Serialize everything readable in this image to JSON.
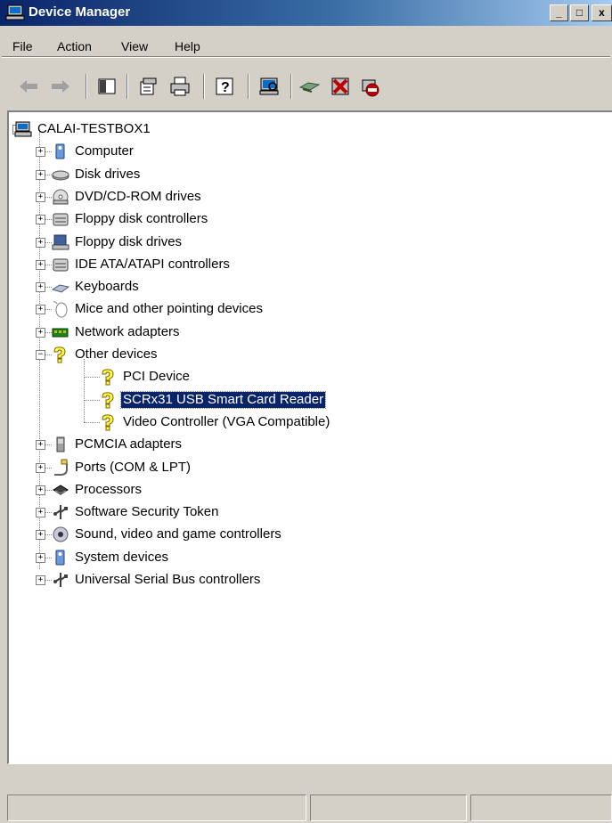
{
  "window": {
    "title": "Device Manager"
  },
  "titlebar": {
    "minimize": "_",
    "maximize": "□",
    "close": "x"
  },
  "menu": [
    "File",
    "Action",
    "View",
    "Help"
  ],
  "toolbar": [
    "back-icon",
    "forward-icon",
    "show-hide-tree-icon",
    "properties-icon",
    "print-icon",
    "help-icon",
    "scan-hardware-icon",
    "update-driver-icon",
    "uninstall-icon",
    "disable-icon"
  ],
  "tree": {
    "root": "CALAI-TESTBOX1",
    "categories": [
      {
        "label": "Computer",
        "icon": "computer-icon"
      },
      {
        "label": "Disk drives",
        "icon": "disk-drive-icon"
      },
      {
        "label": "DVD/CD-ROM drives",
        "icon": "dvd-drive-icon"
      },
      {
        "label": "Floppy disk controllers",
        "icon": "floppy-controller-icon"
      },
      {
        "label": "Floppy disk drives",
        "icon": "floppy-drive-icon"
      },
      {
        "label": "IDE ATA/ATAPI controllers",
        "icon": "ide-controller-icon"
      },
      {
        "label": "Keyboards",
        "icon": "keyboard-icon"
      },
      {
        "label": "Mice and other pointing devices",
        "icon": "mouse-icon"
      },
      {
        "label": "Network adapters",
        "icon": "network-adapter-icon"
      },
      {
        "label": "Other devices",
        "icon": "unknown-device-icon",
        "expanded": true,
        "children": [
          {
            "label": "PCI Device",
            "icon": "unknown-device-icon"
          },
          {
            "label": "SCRx31 USB Smart Card Reader",
            "icon": "unknown-device-icon",
            "selected": true
          },
          {
            "label": "Video Controller (VGA Compatible)",
            "icon": "unknown-device-icon"
          }
        ]
      },
      {
        "label": "PCMCIA adapters",
        "icon": "pcmcia-icon"
      },
      {
        "label": "Ports (COM & LPT)",
        "icon": "port-icon"
      },
      {
        "label": "Processors",
        "icon": "processor-icon"
      },
      {
        "label": "Software Security Token",
        "icon": "usb-icon"
      },
      {
        "label": "Sound, video and game controllers",
        "icon": "sound-icon"
      },
      {
        "label": "System devices",
        "icon": "system-device-icon"
      },
      {
        "label": "Universal Serial Bus controllers",
        "icon": "usb-icon"
      }
    ]
  },
  "expander": {
    "plus": "+",
    "minus": "−"
  }
}
